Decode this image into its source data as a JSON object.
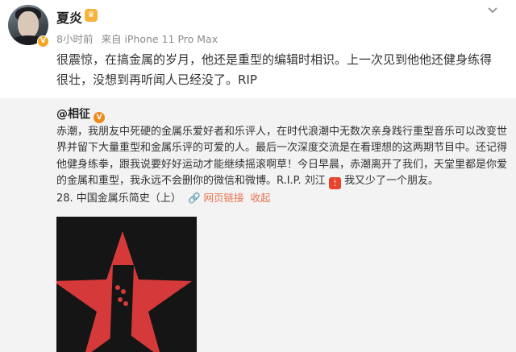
{
  "post": {
    "author": "夏炎",
    "author_badge_icon": "crown-icon",
    "time": "8小时前",
    "source": "来自 iPhone 11 Pro Max",
    "text": "很震惊，在搞金属的岁月，他还是重型的编辑时相识。上一次见到他他还健身练得很壮，没想到再听闻人已经没了。RIP"
  },
  "repost": {
    "mention": "@相征",
    "p1": "赤潮，我朋友中死硬的金属乐爱好者和乐评人，在时代浪潮中无数次亲身践行重型音乐可以改变世界并留下大量重型和金属乐评的可爱的人。最后一次深度交流是在看理想的这两期节目中。还记得他健身练拳，跟我说要好好运动才能继续摇滚啊草！今日早晨，赤潮离开了我们，天堂里都是你爱的金属和重型，我永远不会删你的微信和微博。R.I.P. 刘江",
    "p1_end": " 我又少了一个朋友。",
    "list_item": "28. 中国金属乐简史（上）",
    "link_label": "网页链接",
    "collect_label": "收起"
  },
  "colors": {
    "link": "#eb7350",
    "repost_bg": "#f3f3f3",
    "star": "#d6393a"
  }
}
